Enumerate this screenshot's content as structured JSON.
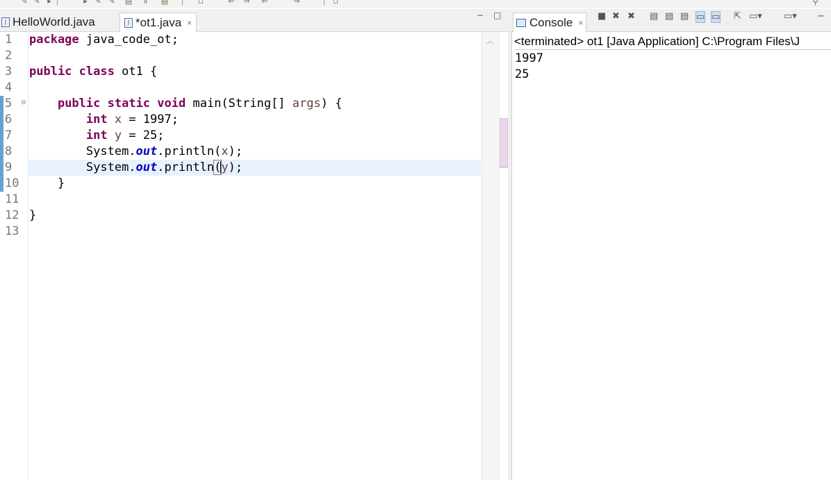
{
  "editor": {
    "tabs": [
      {
        "label": "HelloWorld.java",
        "active": false
      },
      {
        "label": "*ot1.java",
        "active": true
      }
    ],
    "line_numbers": [
      "1",
      "2",
      "3",
      "4",
      "5",
      "6",
      "7",
      "8",
      "9",
      "10",
      "11",
      "12",
      "13"
    ],
    "code": {
      "l1_kw": "package",
      "l1_rest": " java_code_ot;",
      "l3_kw1": "public",
      "l3_kw2": "class",
      "l3_rest": " ot1 {",
      "l5_kw1": "public",
      "l5_kw2": "static",
      "l5_kw3": "void",
      "l5_mid": " main(String[] ",
      "l5_var": "args",
      "l5_end": ") {",
      "l6_kw": "int",
      "l6_var": "x",
      "l6_rest": " = 1997;",
      "l7_kw": "int",
      "l7_var": "y",
      "l7_rest": " = 25;",
      "l8_a": "System.",
      "l8_field": "out",
      "l8_b": ".println(",
      "l8_var": "x",
      "l8_c": ");",
      "l9_a": "System.",
      "l9_field": "out",
      "l9_b": ".println",
      "l9_paren": "(",
      "l9_var": "y",
      "l9_c": ");",
      "l10": "}",
      "l12": "}"
    }
  },
  "console": {
    "tab_label": "Console",
    "status": "<terminated> ot1 [Java Application] C:\\Program Files\\J",
    "output": [
      "1997",
      "25"
    ]
  },
  "icons": {
    "close": "×",
    "minimize": "−",
    "maximize": "□"
  },
  "colors": {
    "keyword": "#7f0055",
    "variable": "#6a3e3e",
    "field": "#0000c0",
    "current_line": "#e8f2fe"
  }
}
